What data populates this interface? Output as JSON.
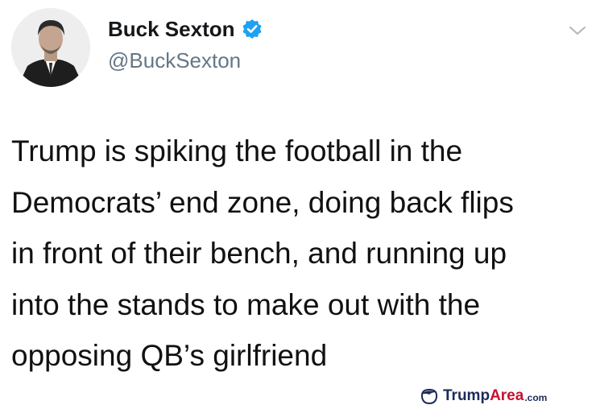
{
  "author": {
    "display_name": "Buck Sexton",
    "handle": "@BuckSexton",
    "verified": true,
    "avatar_icon": "profile-photo",
    "verified_icon": "verified-badge-icon",
    "verified_color": "#1da1f2"
  },
  "menu": {
    "icon": "chevron-down-icon"
  },
  "tweet": {
    "lines": [
      "Trump is spiking the football in the",
      "Democrats’ end zone, doing back flips",
      "in front of their bench, and running up",
      "into the stands to make out with the",
      "opposing QB’s girlfriend"
    ]
  },
  "watermark": {
    "icon": "trump-hair-icon",
    "word1": "Trump",
    "word2": "Area",
    "tld": ".com",
    "colors": {
      "navy": "#1c2b5a",
      "red": "#c8102e"
    }
  }
}
